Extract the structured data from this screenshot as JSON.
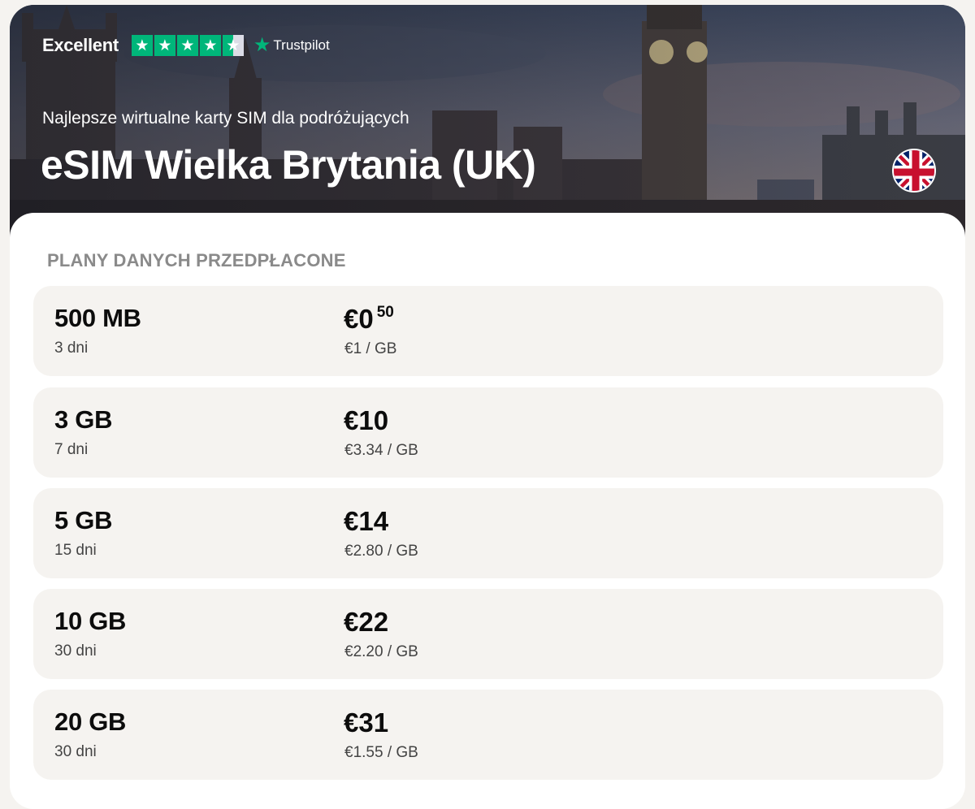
{
  "trustpilot": {
    "rating_label": "Excellent",
    "stars": 4.5,
    "brand": "Trustpilot"
  },
  "hero": {
    "subtitle": "Najlepsze wirtualne karty SIM dla podróżujących",
    "title": "eSIM Wielka Brytania (UK)",
    "flag": "uk-flag-icon"
  },
  "section": {
    "label": "PLANY DANYCH PRZEDPŁACONE"
  },
  "plans": [
    {
      "data": "500 MB",
      "days": "3 dni",
      "price": "€0",
      "price_cents": "50",
      "per_gb": "€1 / GB"
    },
    {
      "data": "3 GB",
      "days": "7 dni",
      "price": "€10",
      "price_cents": "",
      "per_gb": "€3.34 / GB"
    },
    {
      "data": "5 GB",
      "days": "15 dni",
      "price": "€14",
      "price_cents": "",
      "per_gb": "€2.80 / GB"
    },
    {
      "data": "10 GB",
      "days": "30 dni",
      "price": "€22",
      "price_cents": "",
      "per_gb": "€2.20 / GB"
    },
    {
      "data": "20 GB",
      "days": "30 dni",
      "price": "€31",
      "price_cents": "",
      "per_gb": "€1.55 / GB"
    }
  ],
  "colors": {
    "trustpilot_green": "#00b67a",
    "plan_bg": "#f5f3f0",
    "label_gray": "#8a8a8a"
  }
}
